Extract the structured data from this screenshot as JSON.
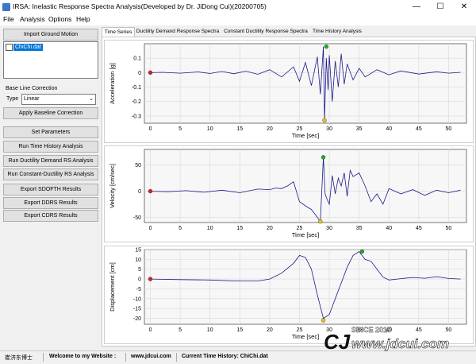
{
  "window": {
    "title": "IRSA: Inelastic Response Spectra Analysis(Developed by Dr. JiDong Cui)(20200705)",
    "min_glyph": "—",
    "max_glyph": "☐",
    "close_glyph": "✕"
  },
  "menu": [
    "File",
    "Analysis",
    "Options",
    "Help"
  ],
  "left_panel": {
    "import_button": "Import Ground Motion",
    "record_files": [
      {
        "name": "ChiChi.dat",
        "selected": true,
        "checked": false
      }
    ],
    "baseline_group_label": "Base Line Correction",
    "type_label": "Type",
    "type_value": "Linear",
    "apply_baseline_button": "Apply Baseline Correction",
    "buttons": [
      "Set Parameters",
      "Run Time History Analysis",
      "Run Ductility Demand RS Analysis",
      "Run Constant-Ductility RS Analysis",
      "Export SDOFTH Results",
      "Export DDRS Results",
      "Export CDRS Results"
    ]
  },
  "tabs": [
    {
      "label": "Time Series",
      "active": true
    },
    {
      "label": "Ductility Demand Response Spectra",
      "active": false
    },
    {
      "label": "Constant Ductility Response Spectra",
      "active": false
    },
    {
      "label": "Time History Analysis",
      "active": false
    }
  ],
  "status": {
    "author": "崔济东博士",
    "welcome": "Welcome to my Website :",
    "website": "www.jdcui.com",
    "current": "Current Time History: ChiChi.dat"
  },
  "watermark": {
    "logo": "CJ",
    "since": "SINCE 2015",
    "url": "www.jdcui.com"
  },
  "colors": {
    "line": "#1a1a8c",
    "start_marker": "#d62020",
    "max_marker": "#22b022",
    "min_marker": "#e6c020"
  },
  "chart_data": [
    {
      "type": "line",
      "xlabel": "Time [sec]",
      "ylabel": "Acceleration [g]",
      "xlim": [
        -1,
        53
      ],
      "ylim": [
        -0.35,
        0.2
      ],
      "xticks": [
        0,
        5,
        10,
        15,
        20,
        25,
        30,
        35,
        40,
        45,
        50
      ],
      "yticks": [
        0.1,
        0,
        -0.1,
        -0.2,
        -0.3
      ],
      "ytick_labels": [
        "0.1",
        "0",
        "-0.1",
        "-0.2",
        "-0.3"
      ],
      "x": [
        0,
        2,
        5,
        8,
        10,
        12,
        14,
        16,
        18,
        20,
        22,
        24,
        25,
        26,
        27,
        28,
        28.5,
        29,
        29.2,
        29.5,
        29.8,
        30,
        30.5,
        31,
        31.5,
        32,
        32.5,
        33,
        34,
        35,
        36,
        38,
        40,
        42,
        45,
        48,
        50,
        52
      ],
      "y": [
        0,
        0.002,
        -0.004,
        0.005,
        -0.006,
        0.008,
        -0.008,
        0.01,
        -0.012,
        0.02,
        -0.03,
        0.04,
        -0.06,
        0.07,
        -0.09,
        0.11,
        -0.15,
        0.18,
        -0.33,
        0.1,
        -0.12,
        0.12,
        -0.2,
        0.08,
        -0.1,
        0.13,
        -0.08,
        0.06,
        -0.05,
        0.03,
        -0.03,
        0.02,
        -0.015,
        0.012,
        -0.01,
        0.006,
        -0.004,
        0.002
      ],
      "markers": {
        "start": [
          0,
          0
        ],
        "max": [
          29.5,
          0.18
        ],
        "min": [
          29.2,
          -0.33
        ]
      }
    },
    {
      "type": "line",
      "xlabel": "Time [sec]",
      "ylabel": "Velocity [cm/sec]",
      "xlim": [
        -1,
        53
      ],
      "ylim": [
        -60,
        80
      ],
      "xticks": [
        0,
        5,
        10,
        15,
        20,
        25,
        30,
        35,
        40,
        45,
        50
      ],
      "yticks": [
        50,
        0,
        -50
      ],
      "ytick_labels": [
        "50",
        "0",
        "-50"
      ],
      "x": [
        0,
        3,
        6,
        9,
        12,
        15,
        18,
        20,
        21,
        22,
        23,
        24,
        25,
        26,
        27,
        28,
        28.5,
        29,
        29.3,
        29.6,
        30,
        30.5,
        31,
        31.5,
        32,
        32.5,
        33,
        33.5,
        34,
        35,
        36,
        37,
        38,
        39,
        40,
        42,
        44,
        46,
        48,
        50,
        52
      ],
      "y": [
        0,
        -1,
        1,
        -2,
        2,
        -3,
        4,
        3,
        6,
        5,
        10,
        18,
        -20,
        -28,
        -35,
        -50,
        -58,
        65,
        -5,
        -15,
        -25,
        30,
        -5,
        25,
        10,
        35,
        -10,
        40,
        28,
        35,
        10,
        -20,
        -5,
        -25,
        5,
        -5,
        3,
        -8,
        2,
        -3,
        2
      ],
      "markers": {
        "start": [
          0,
          0
        ],
        "max": [
          29.0,
          65
        ],
        "min": [
          28.5,
          -58
        ]
      }
    },
    {
      "type": "line",
      "xlabel": "Time [sec]",
      "ylabel": "Displacement [cm]",
      "xlim": [
        -1,
        53
      ],
      "ylim": [
        -23,
        15
      ],
      "xticks": [
        0,
        5,
        10,
        15,
        20,
        25,
        30,
        35,
        40,
        45,
        50
      ],
      "yticks": [
        15,
        10,
        5,
        0,
        -5,
        -10,
        -15,
        -20
      ],
      "ytick_labels": [
        "15",
        "10",
        "5",
        "0",
        "-5",
        "-10",
        "-15",
        "-20"
      ],
      "x": [
        0,
        5,
        10,
        15,
        18,
        20,
        22,
        24,
        25,
        26,
        27,
        28,
        29,
        30,
        31,
        32,
        33,
        34,
        35,
        36,
        37,
        38,
        39,
        40,
        42,
        44,
        46,
        48,
        50,
        52
      ],
      "y": [
        0,
        -0.3,
        -0.5,
        -1,
        -1,
        0,
        3,
        8,
        12,
        11,
        5,
        -8,
        -20,
        -18,
        -10,
        -2,
        6,
        12,
        14,
        10,
        9,
        5,
        1,
        -0.5,
        0.2,
        0.8,
        0.4,
        1.2,
        0.3,
        0
      ],
      "markers": {
        "start": [
          0,
          0
        ],
        "max": [
          35.5,
          14
        ],
        "min": [
          29,
          -21
        ]
      }
    }
  ]
}
